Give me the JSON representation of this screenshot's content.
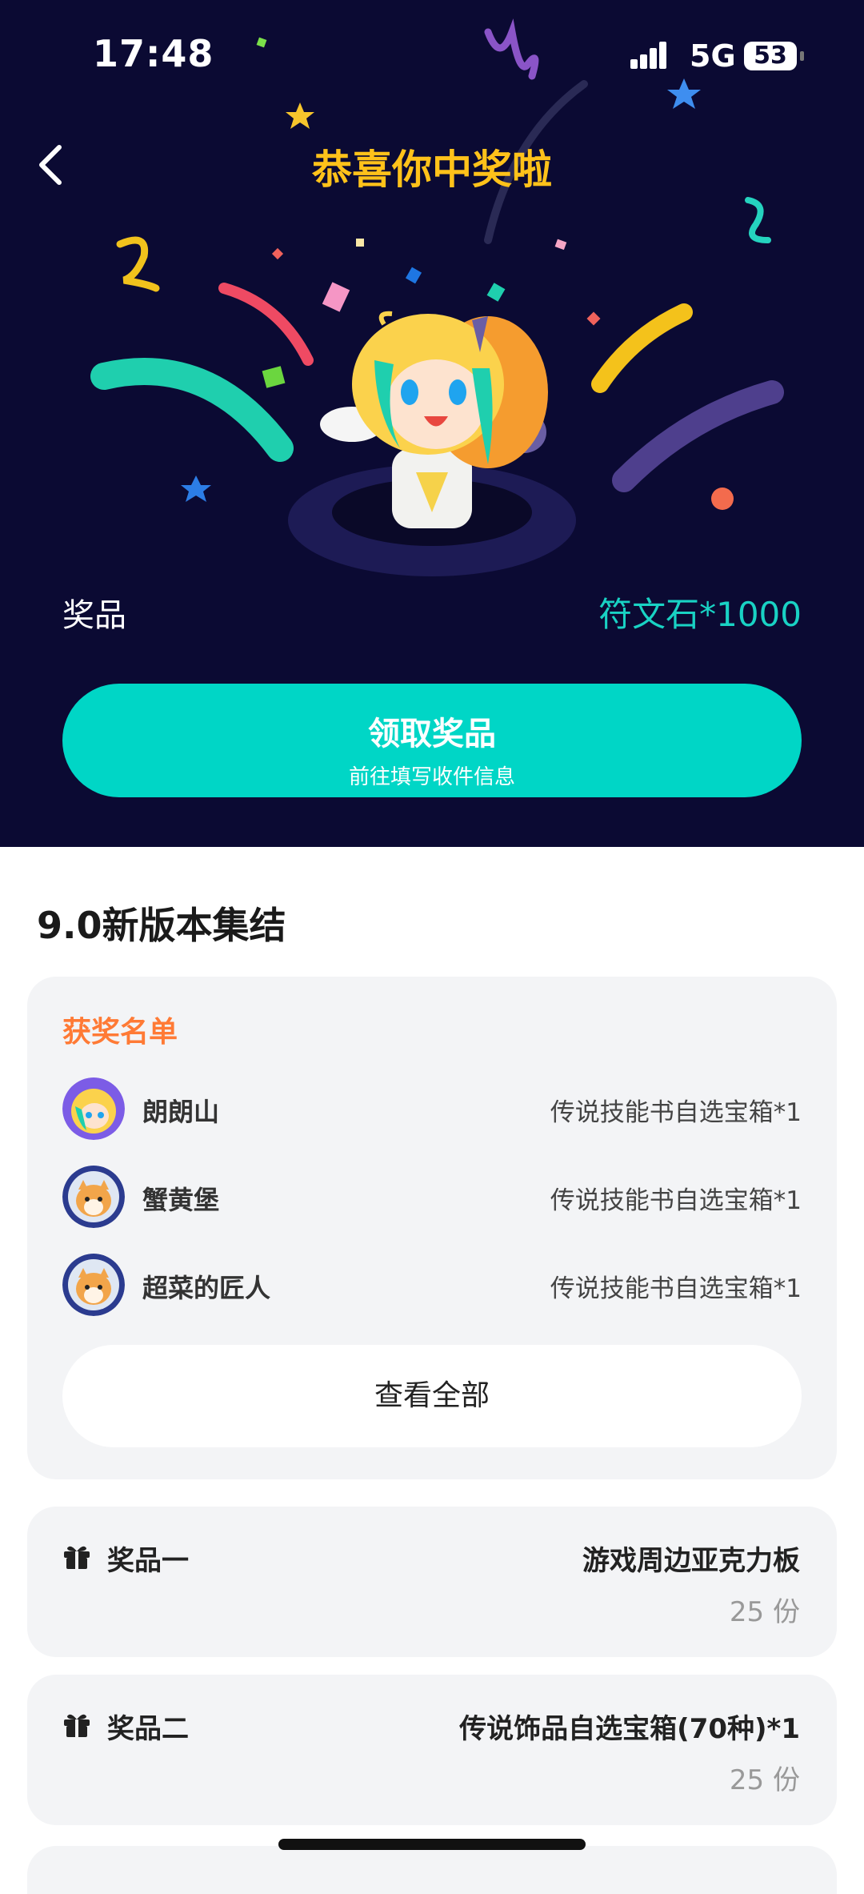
{
  "status_bar": {
    "time": "17:48",
    "network": "5G",
    "battery": "53"
  },
  "header": {
    "title": "恭喜你中奖啦"
  },
  "prize": {
    "label": "奖品",
    "value": "符文石*1000"
  },
  "claim_button": {
    "label": "领取奖品",
    "sublabel": "前往填写收件信息"
  },
  "event": {
    "title": "9.0新版本集结"
  },
  "winners": {
    "heading": "获奖名单",
    "rows": [
      {
        "name": "朗朗山",
        "prize": "传说技能书自选宝箱*1"
      },
      {
        "name": "蟹黄堡",
        "prize": "传说技能书自选宝箱*1"
      },
      {
        "name": "超菜的匠人",
        "prize": "传说技能书自选宝箱*1"
      }
    ],
    "view_all": "查看全部"
  },
  "prize_list": [
    {
      "label": "奖品一",
      "name": "游戏周边亚克力板",
      "quantity": "25 份"
    },
    {
      "label": "奖品二",
      "name": "传说饰品自选宝箱(70种)*1",
      "quantity": "25 份"
    }
  ],
  "colors": {
    "hero_bg": "#0b0a33",
    "title": "#ffc21a",
    "accent": "#00d6c6",
    "winners_heading": "#ff7a35",
    "card_bg": "#f3f4f6"
  },
  "icons": [
    "back-chevron-icon",
    "signal-icon",
    "battery-icon",
    "gift-icon"
  ]
}
